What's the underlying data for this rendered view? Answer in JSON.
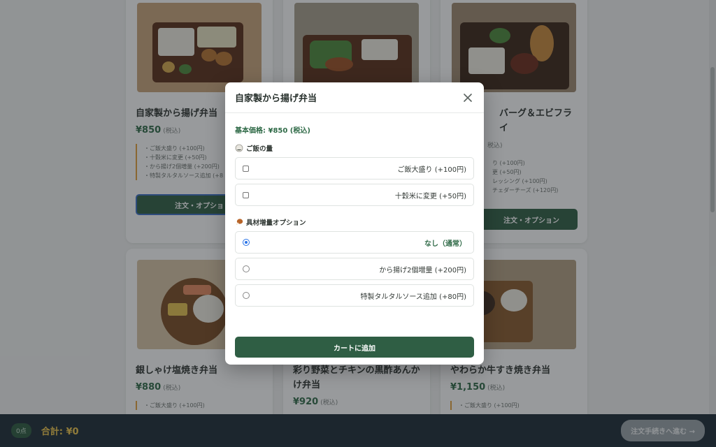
{
  "cards": [
    {
      "name": "自家製から揚げ弁当",
      "price": "¥850",
      "tax": "(税込)",
      "options": [
        "・ご飯大盛り (+100円)",
        "・十穀米に変更 (+50円)",
        "・から揚げ2個増量 (+200円)",
        "・特製タルタルソース追加 (+8"
      ],
      "button": "注文・オプショ"
    },
    {
      "name": "バーグ＆エビフライ",
      "price": "",
      "tax": "税込)",
      "options": [
        "り (+100円)",
        "更 (+50円)",
        "レッシング (+100円)",
        "チェダーチーズ (+120円)"
      ],
      "button": "注文・オプション"
    },
    {
      "name": "銀しゃけ塩焼き弁当",
      "price": "¥880",
      "tax": "(税込)",
      "options": [
        "・ご飯大盛り (+100円)"
      ],
      "button": ""
    },
    {
      "name": "彩り野菜とチキンの黒酢あんかけ弁当",
      "price": "¥920",
      "tax": "(税込)",
      "options": [],
      "button": ""
    },
    {
      "name": "やわらか牛すき焼き弁当",
      "price": "¥1,150",
      "tax": "(税込)",
      "options": [
        "・ご飯大盛り (+100円)"
      ],
      "button": ""
    }
  ],
  "bottom_bar": {
    "count": "0点",
    "total": "合計: ¥0",
    "checkout": "注文手続きへ進む →"
  },
  "modal": {
    "title": "自家製から揚げ弁当",
    "base_price": "基本価格: ¥850 (税込)",
    "rice_section": {
      "icon": "rice-ball-icon",
      "title": "ご飯の量",
      "options": [
        {
          "label": "ご飯大盛り (+100円)",
          "checked": false
        },
        {
          "label": "十穀米に変更 (+50円)",
          "checked": false
        }
      ]
    },
    "topping_section": {
      "icon": "drumstick-icon",
      "title": "具材増量オプション",
      "options": [
        {
          "label": "なし（通常）",
          "selected": true
        },
        {
          "label": "から揚げ2個増量 (+200円)",
          "selected": false
        },
        {
          "label": "特製タルタルソース追加 (+80円)",
          "selected": false
        }
      ]
    },
    "add_to_cart": "カートに追加"
  },
  "colors": {
    "accent": "#2f5e44",
    "price_green": "#2f6a47",
    "total_yellow": "#f0c64a",
    "bar_bg": "#1b2a35"
  }
}
